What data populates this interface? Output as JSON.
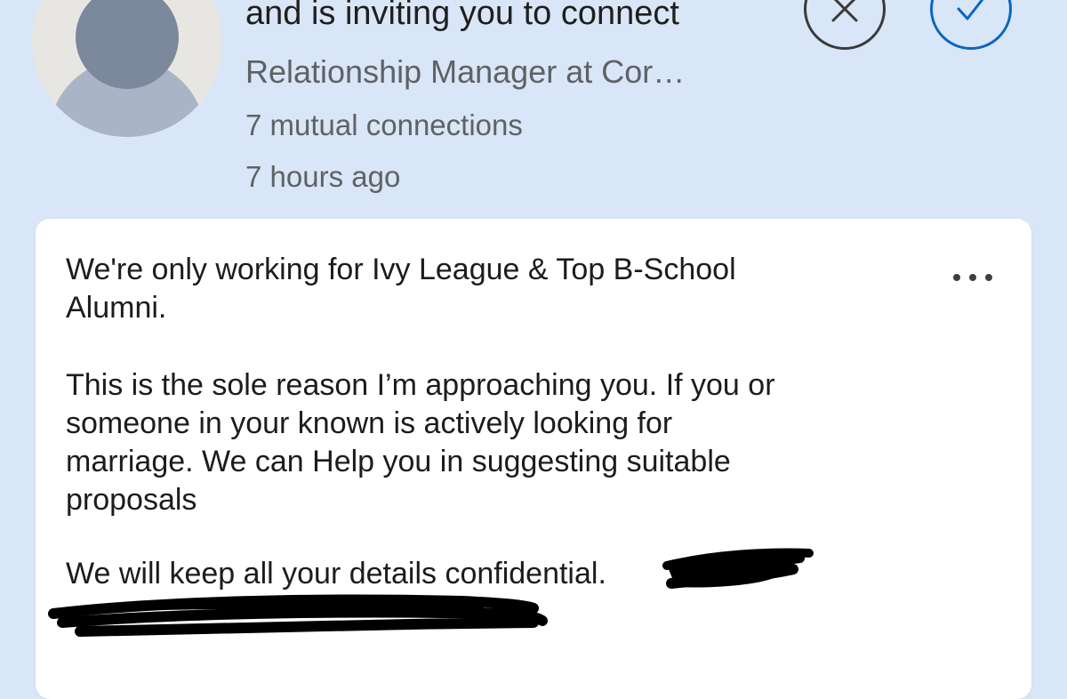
{
  "invitation": {
    "headline": "and is inviting you to connect",
    "title": "Relationship Manager at Cor…",
    "mutual_connections": "7 mutual connections",
    "time_ago": "7 hours ago",
    "avatar_icon": "person-icon",
    "ignore_icon": "close-icon",
    "accept_icon": "check-icon"
  },
  "message": {
    "paragraph_1": "We're only working for Ivy League & Top B-School\nAlumni.",
    "paragraph_2": "This is the sole reason I’m approaching you. If you or\nsomeone in your known is actively looking for\nmarriage. We can Help you in suggesting suitable\nproposals",
    "paragraph_3": "We will keep all your details confidential.",
    "more_icon": "more-horizontal-icon"
  },
  "colors": {
    "background": "#d9e6f7",
    "card": "#ffffff",
    "accent": "#0a66c2",
    "secondary_text": "#5f6265"
  }
}
